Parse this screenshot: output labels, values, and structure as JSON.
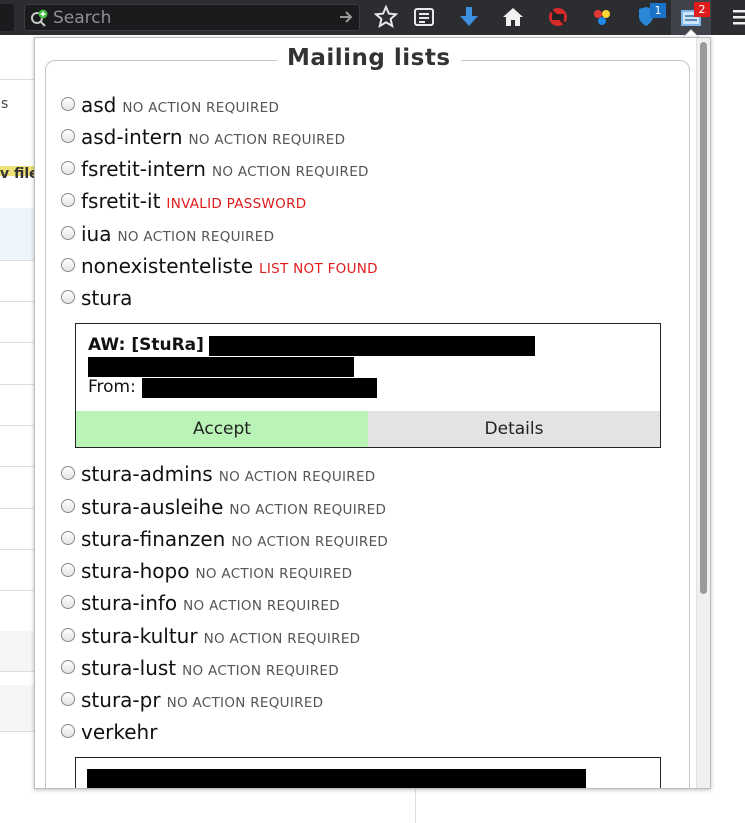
{
  "toolbar": {
    "search_placeholder": "Search",
    "downloads_badge": "1",
    "extension_badge": "2"
  },
  "page": {
    "left_text_s": "s",
    "left_button_text": "v file"
  },
  "popup": {
    "title": "Mailing lists",
    "lists": [
      {
        "name": "asd",
        "status": "NO ACTION REQUIRED",
        "status_type": "ok"
      },
      {
        "name": "asd-intern",
        "status": "NO ACTION REQUIRED",
        "status_type": "ok"
      },
      {
        "name": "fsretit-intern",
        "status": "NO ACTION REQUIRED",
        "status_type": "ok"
      },
      {
        "name": "fsretit-it",
        "status": "INVALID PASSWORD",
        "status_type": "error"
      },
      {
        "name": "iua",
        "status": "NO ACTION REQUIRED",
        "status_type": "ok"
      },
      {
        "name": "nonexistenteliste",
        "status": "LIST NOT FOUND",
        "status_type": "error"
      },
      {
        "name": "stura",
        "status": "",
        "status_type": "pending"
      },
      {
        "name": "stura-admins",
        "status": "NO ACTION REQUIRED",
        "status_type": "ok"
      },
      {
        "name": "stura-ausleihe",
        "status": "NO ACTION REQUIRED",
        "status_type": "ok"
      },
      {
        "name": "stura-finanzen",
        "status": "NO ACTION REQUIRED",
        "status_type": "ok"
      },
      {
        "name": "stura-hopo",
        "status": "NO ACTION REQUIRED",
        "status_type": "ok"
      },
      {
        "name": "stura-info",
        "status": "NO ACTION REQUIRED",
        "status_type": "ok"
      },
      {
        "name": "stura-kultur",
        "status": "NO ACTION REQUIRED",
        "status_type": "ok"
      },
      {
        "name": "stura-lust",
        "status": "NO ACTION REQUIRED",
        "status_type": "ok"
      },
      {
        "name": "stura-pr",
        "status": "NO ACTION REQUIRED",
        "status_type": "ok"
      },
      {
        "name": "verkehr",
        "status": "",
        "status_type": "pending"
      }
    ],
    "message": {
      "subject_prefix": "AW: [StuRa]",
      "from_label": "From:",
      "accept_label": "Accept",
      "details_label": "Details"
    }
  },
  "colors": {
    "error": "#e01b1b",
    "accept_bg": "#b9f4b6",
    "details_bg": "#e3e3e3"
  }
}
